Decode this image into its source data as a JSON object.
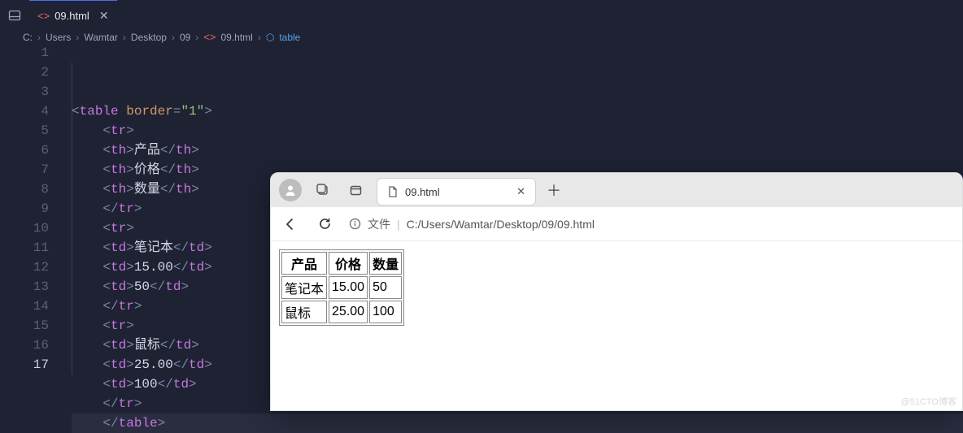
{
  "editor": {
    "tab_label": "09.html",
    "breadcrumbs": [
      "C:",
      "Users",
      "Wamtar",
      "Desktop",
      "09",
      "09.html",
      "table"
    ],
    "code": [
      {
        "indent": 0,
        "type": "open",
        "tag": "table",
        "attr": "border",
        "val": "\"1\""
      },
      {
        "indent": 1,
        "type": "open",
        "tag": "tr"
      },
      {
        "indent": 1,
        "type": "pair",
        "tag": "th",
        "text": "产品"
      },
      {
        "indent": 1,
        "type": "pair",
        "tag": "th",
        "text": "价格"
      },
      {
        "indent": 1,
        "type": "pair",
        "tag": "th",
        "text": "数量"
      },
      {
        "indent": 1,
        "type": "close",
        "tag": "tr"
      },
      {
        "indent": 1,
        "type": "open",
        "tag": "tr"
      },
      {
        "indent": 1,
        "type": "pair",
        "tag": "td",
        "text": "笔记本"
      },
      {
        "indent": 1,
        "type": "pair",
        "tag": "td",
        "text": "15.00"
      },
      {
        "indent": 1,
        "type": "pair",
        "tag": "td",
        "text": "50"
      },
      {
        "indent": 1,
        "type": "close",
        "tag": "tr"
      },
      {
        "indent": 1,
        "type": "open",
        "tag": "tr"
      },
      {
        "indent": 1,
        "type": "pair",
        "tag": "td",
        "text": "鼠标"
      },
      {
        "indent": 1,
        "type": "pair",
        "tag": "td",
        "text": "25.00"
      },
      {
        "indent": 1,
        "type": "pair",
        "tag": "td",
        "text": "100"
      },
      {
        "indent": 1,
        "type": "close",
        "tag": "tr"
      },
      {
        "indent": 1,
        "type": "close",
        "tag": "table"
      }
    ]
  },
  "browser": {
    "tab_label": "09.html",
    "addr_label": "文件",
    "addr_path": "C:/Users/Wamtar/Desktop/09/09.html",
    "table": {
      "headers": [
        "产品",
        "价格",
        "数量"
      ],
      "rows": [
        [
          "笔记本",
          "15.00",
          "50"
        ],
        [
          "鼠标",
          "25.00",
          "100"
        ]
      ]
    }
  },
  "watermark": "@51CTO博客"
}
